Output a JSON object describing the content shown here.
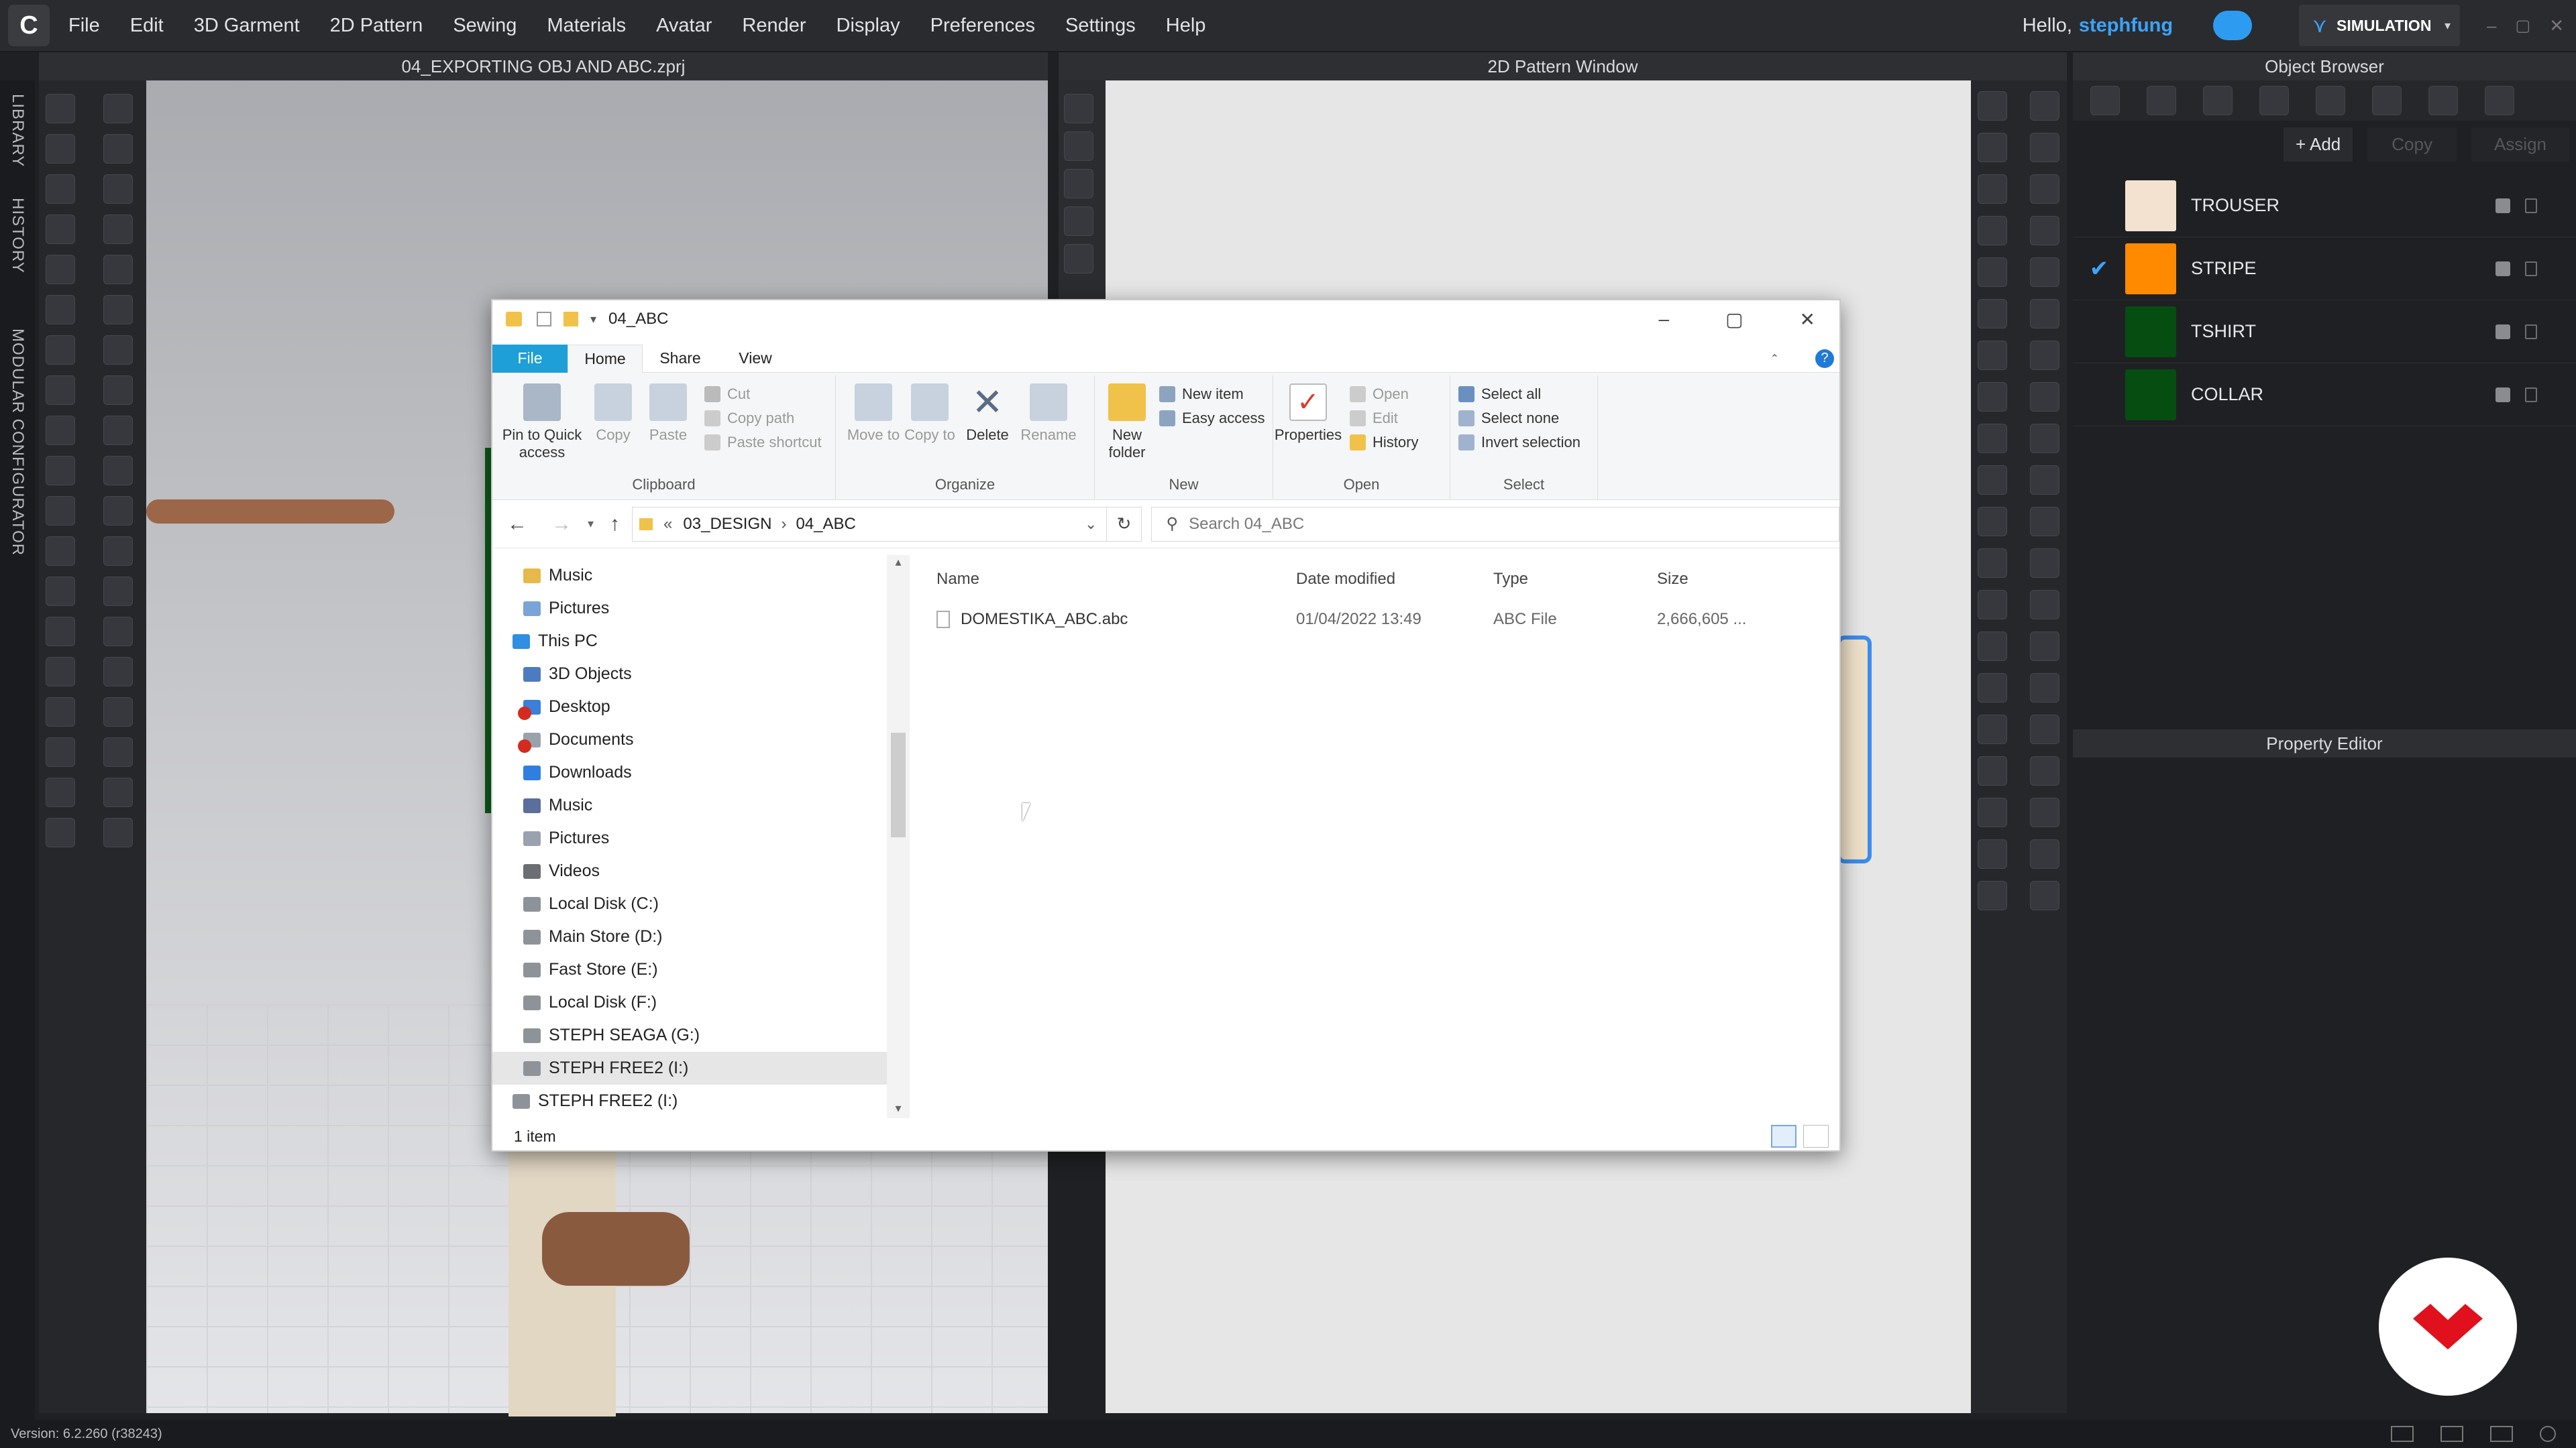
{
  "menubar": {
    "logo": "C",
    "items": [
      "File",
      "Edit",
      "3D Garment",
      "2D Pattern",
      "Sewing",
      "Materials",
      "Avatar",
      "Render",
      "Display",
      "Preferences",
      "Settings",
      "Help"
    ],
    "greeting": "Hello,",
    "username": "stephfung",
    "mode": "SIMULATION"
  },
  "left_tabs": {
    "library": "LIBRARY",
    "history": "HISTORY",
    "modular": "MODULAR CONFIGURATOR"
  },
  "viewport3d": {
    "title": "04_EXPORTING OBJ AND ABC.zprj"
  },
  "pattern_window": {
    "title": "2D Pattern Window"
  },
  "object_browser": {
    "title": "Object Browser",
    "add": "+ Add",
    "copy": "Copy",
    "assign": "Assign",
    "items": [
      {
        "name": "TROUSER",
        "color": "#f3e2cf",
        "selected": false
      },
      {
        "name": "STRIPE",
        "color": "#ff8a00",
        "selected": true
      },
      {
        "name": "TSHIRT",
        "color": "#064d12",
        "selected": false
      },
      {
        "name": "COLLAR",
        "color": "#064d12",
        "selected": false
      }
    ]
  },
  "property_editor": {
    "title": "Property Editor"
  },
  "status": {
    "version": "Version: 6.2.260 (r38243)"
  },
  "explorer": {
    "title": "04_ABC",
    "tabs": {
      "file": "File",
      "home": "Home",
      "share": "Share",
      "view": "View"
    },
    "clipboard": {
      "pin": "Pin to Quick access",
      "copy": "Copy",
      "paste": "Paste",
      "cut": "Cut",
      "copy_path": "Copy path",
      "paste_shortcut": "Paste shortcut",
      "label": "Clipboard"
    },
    "organize": {
      "move": "Move to",
      "copy": "Copy to",
      "delete": "Delete",
      "rename": "Rename",
      "label": "Organize"
    },
    "new": {
      "folder": "New folder",
      "item": "New item",
      "easy": "Easy access",
      "label": "New"
    },
    "open": {
      "properties": "Properties",
      "open": "Open",
      "edit": "Edit",
      "history": "History",
      "label": "Open"
    },
    "select": {
      "all": "Select all",
      "none": "Select none",
      "invert": "Invert selection",
      "label": "Select"
    },
    "address": {
      "prefix": "«",
      "seg1": "03_DESIGN",
      "seg2": "04_ABC"
    },
    "search_placeholder": "Search 04_ABC",
    "nav": [
      "Music",
      "Pictures",
      "This PC",
      "3D Objects",
      "Desktop",
      "Documents",
      "Downloads",
      "Music",
      "Pictures",
      "Videos",
      "Local Disk (C:)",
      "Main Store (D:)",
      "Fast Store (E:)",
      "Local Disk (F:)",
      "STEPH SEAGA (G:)",
      "STEPH FREE2 (I:)",
      "STEPH FREE2 (I:)"
    ],
    "columns": {
      "name": "Name",
      "date": "Date modified",
      "type": "Type",
      "size": "Size"
    },
    "files": [
      {
        "name": "DOMESTIKA_ABC.abc",
        "date": "01/04/2022 13:49",
        "type": "ABC File",
        "size": "2,666,605 ..."
      }
    ],
    "status": "1 item"
  }
}
